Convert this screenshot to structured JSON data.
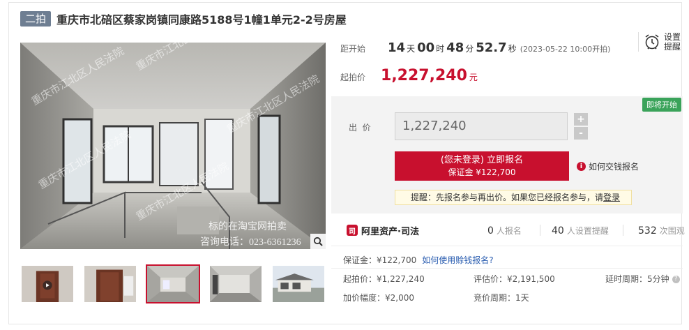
{
  "header": {
    "round_badge": "二拍",
    "title": "重庆市北碚区蔡家岗镇同康路5188号1幢1单元2-2号房屋"
  },
  "gallery": {
    "watermark_lines": [
      "重庆市江北区人民法院",
      "重庆市江北区人民法院",
      "重庆市江北区人民法院",
      "重庆市江北区人民法院",
      "重庆市江北区人民法院"
    ],
    "overlay_line1": "标的在淘宝网拍卖",
    "overlay_line2": "咨询电话：023-6361236",
    "thumb_count": 5,
    "active_index": 2
  },
  "countdown": {
    "label": "距开始",
    "days": "14",
    "days_unit": "天",
    "hours": "00",
    "hours_unit": "时",
    "minutes": "48",
    "minutes_unit": "分",
    "seconds": "52.7",
    "seconds_unit": "秒",
    "start_note": "(2023-05-22 10:00开拍)"
  },
  "reminder": {
    "line1": "设置",
    "line2": "提醒"
  },
  "start_price": {
    "label": "起拍价",
    "value": "1,227,240",
    "unit": "元"
  },
  "bid": {
    "status_tag": "即将开始",
    "label": "出  价",
    "input_value": "1,227,240",
    "plus": "+",
    "minus": "-",
    "signup_line1": "(您未登录) 立即报名",
    "signup_line2": "保证金 ¥122,700",
    "how_pay": "如何交钱报名",
    "tip_prefix": "提醒：先报名参与再出价。如果您已经报名参与，请",
    "tip_link": "登录"
  },
  "stats": {
    "brand": "阿里资产·司法",
    "signups": "0",
    "signups_unit": "人报名",
    "reminders": "40",
    "reminders_unit": "人设置提醒",
    "views": "532",
    "views_unit": "次围观"
  },
  "details": {
    "deposit": "保证金：¥122,700",
    "deposit_link": "如何使用赊钱报名?",
    "start_price": "起拍价：¥1,227,240",
    "appraisal": "评估价：¥2,191,500",
    "delay": "延时周期：5分钟",
    "increment": "加价幅度：¥2,000",
    "period": "竞价周期：1天"
  },
  "colors": {
    "accent_red": "#c8102e",
    "badge_gray": "#6e7e92",
    "status_green": "#3aa35a",
    "link_blue": "#2a5db0"
  }
}
